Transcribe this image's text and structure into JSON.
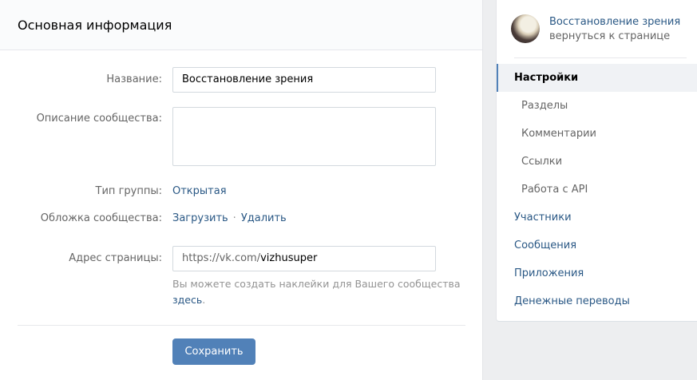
{
  "main": {
    "title": "Основная информация",
    "fields": {
      "name_label": "Название:",
      "name_value": "Восстановление зрения",
      "description_label": "Описание сообщества:",
      "description_value": "",
      "group_type_label": "Тип группы:",
      "group_type_value": "Открытая",
      "cover_label": "Обложка сообщества:",
      "cover_upload": "Загрузить",
      "cover_separator": "·",
      "cover_delete": "Удалить",
      "address_label": "Адрес страницы:",
      "address_prefix": "https://vk.com/",
      "address_value": "vizhusuper"
    },
    "hint_text": "Вы можете создать наклейки для Вашего сообщества",
    "hint_link": "здесь",
    "hint_period": ".",
    "save_label": "Сохранить"
  },
  "sidebar": {
    "profile_name": "Восстановление зрения",
    "profile_back": "вернуться к странице",
    "items": [
      {
        "label": "Настройки",
        "active": true
      },
      {
        "label": "Разделы"
      },
      {
        "label": "Комментарии"
      },
      {
        "label": "Ссылки"
      },
      {
        "label": "Работа с API"
      },
      {
        "label": "Участники"
      },
      {
        "label": "Сообщения"
      },
      {
        "label": "Приложения"
      },
      {
        "label": "Денежные переводы"
      }
    ]
  }
}
